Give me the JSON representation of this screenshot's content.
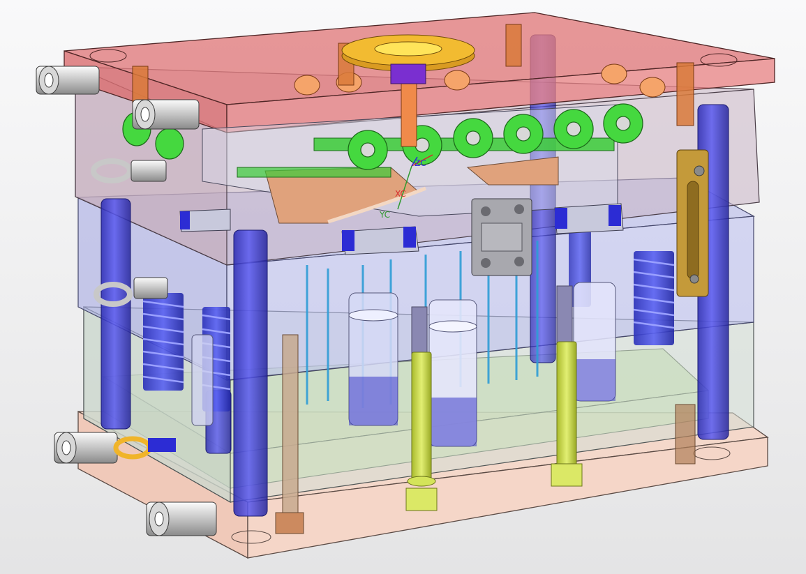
{
  "viewport": {
    "background_top": "#f9f9fa",
    "background_bottom": "#e4e4e5"
  },
  "model": {
    "colors": {
      "top_clamp_plate": "#e0797a",
      "cavity_plate": "#c6b2c0",
      "core_plate": "#b7b9e6",
      "support_plate": "#ced8cf",
      "ejector_plate": "#c6d8a8",
      "bottom_clamp_plate": "#f2cdbf",
      "guide_pillar": "#3a3ad4",
      "spring": "#3f47df",
      "cooling_connector": "#40d43a",
      "sprue_ring": "#f2bb31",
      "return_pin": "#cbdd55",
      "molded_part": "#e0a27c",
      "lock_plate": "#a3a3a9",
      "latch": "#c49a3a"
    }
  },
  "wcs": {
    "x_label": "XC",
    "y_label": "YC",
    "z_label": "ZC"
  }
}
